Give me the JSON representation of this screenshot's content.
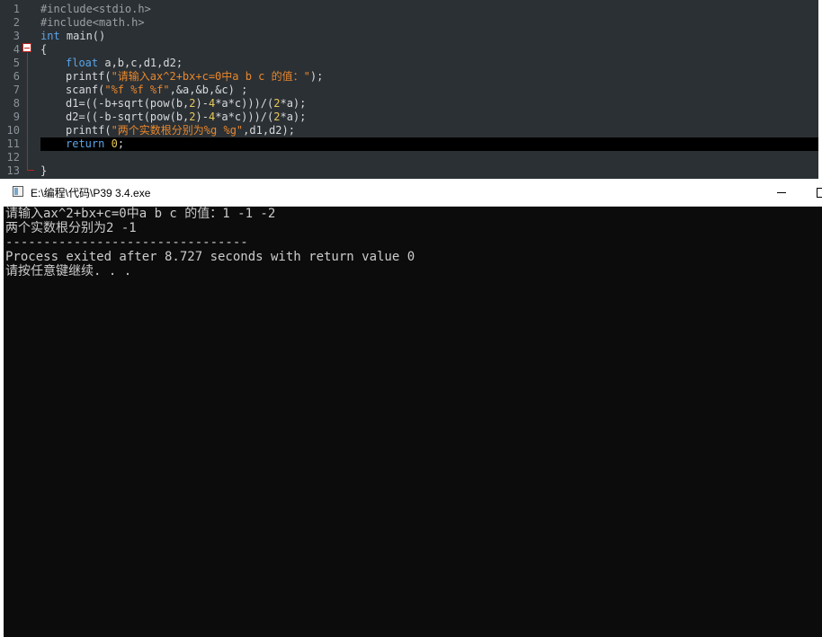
{
  "editor": {
    "line_numbers": [
      "1",
      "2",
      "3",
      "4",
      "5",
      "6",
      "7",
      "8",
      "9",
      "10",
      "11",
      "12",
      "13"
    ],
    "code": {
      "l1": "#include<stdio.h>",
      "l2": "#include<math.h>",
      "l3_kw": "int",
      "l3_rest": " main()",
      "l4": "{",
      "l5_kw": "float",
      "l5_rest": " a,b,c,d1,d2;",
      "l6_a": "printf(",
      "l6_str": "\"请输入ax^2+bx+c=0中a b c 的值：\"",
      "l6_b": ");",
      "l7_a": "scanf(",
      "l7_str": "\"%f %f %f\"",
      "l7_b": ",&a,&b,&c) ;",
      "l8_a": "d1=((-b+sqrt(pow(b,",
      "l8_n1": "2",
      "l8_b": ")-",
      "l8_n2": "4",
      "l8_c": "*a*c)))/(",
      "l8_n3": "2",
      "l8_d": "*a);",
      "l9_a": "d2=((-b-sqrt(pow(b,",
      "l9_n1": "2",
      "l9_b": ")-",
      "l9_n2": "4",
      "l9_c": "*a*c)))/(",
      "l9_n3": "2",
      "l9_d": "*a);",
      "l10_a": "printf(",
      "l10_str": "\"两个实数根分别为%g %g\"",
      "l10_b": ",d1,d2);",
      "l11_kw": "return",
      "l11_sp": " ",
      "l11_num": "0",
      "l11_end": ";",
      "l12": "",
      "l13": "}"
    },
    "current_line": 11
  },
  "console": {
    "title": "E:\\编程\\代码\\P39 3.4.exe",
    "output": [
      "请输入ax^2+bx+c=0中a b c 的值：1 -1 -2",
      "两个实数根分别为2 -1",
      "--------------------------------",
      "Process exited after 8.727 seconds with return value 0",
      "请按任意键继续. . ."
    ]
  },
  "colors": {
    "editor_bg": "#2b3034",
    "keyword": "#5aa4e8",
    "string": "#e8872d",
    "number": "#e8c95a",
    "fold_marker": "#c02020",
    "terminal_bg": "#0c0c0c",
    "terminal_text": "#cccccc"
  }
}
